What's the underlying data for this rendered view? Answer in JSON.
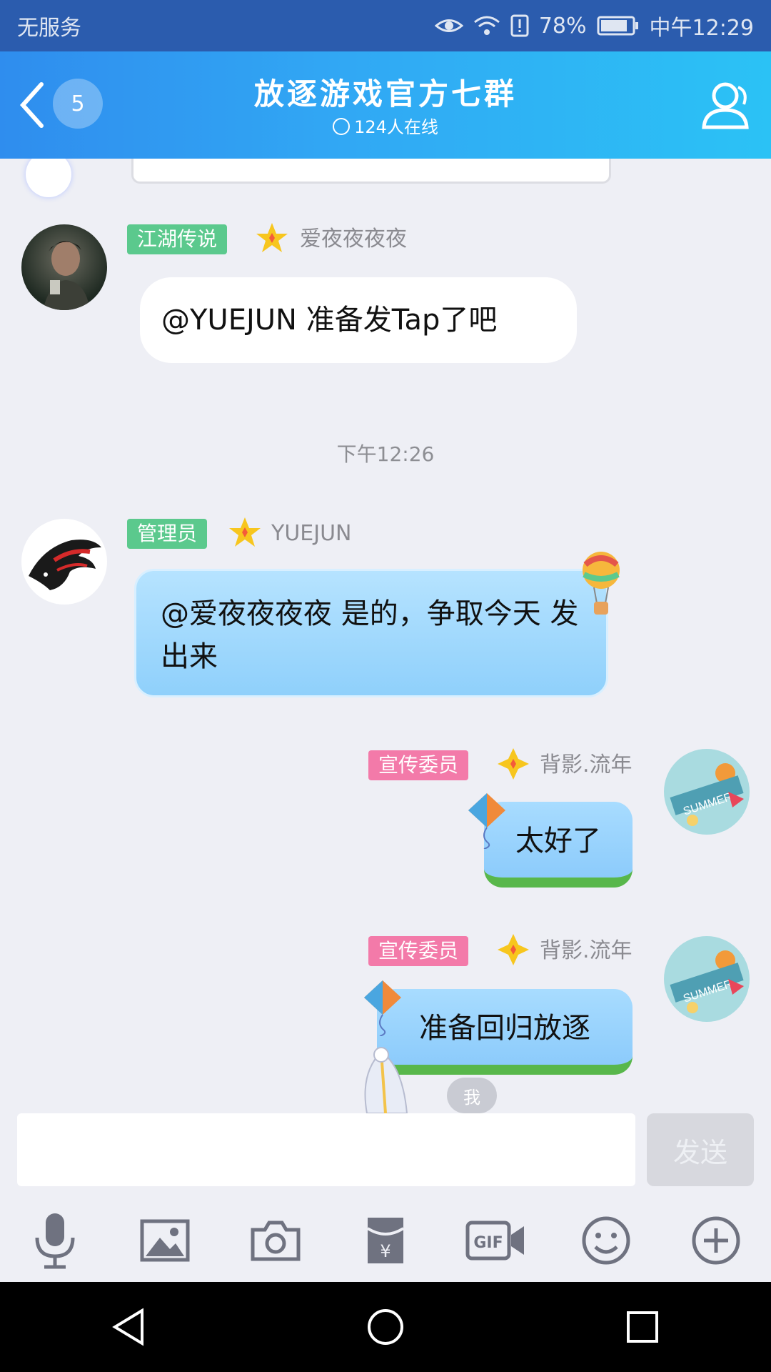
{
  "status_bar": {
    "carrier": "无服务",
    "battery": "78%",
    "time": "中午12:29",
    "icons": [
      "eye-icon",
      "wifi-icon",
      "alert-icon",
      "battery-icon"
    ]
  },
  "header": {
    "unread_count": "5",
    "title": "放逐游戏官方七群",
    "online": "124人在线"
  },
  "messages": [
    {
      "side": "left",
      "tag": "江湖传说",
      "nickname": "爱夜夜夜夜",
      "text": "@YUEJUN 准备发Tap了吧"
    },
    {
      "type": "time",
      "text": "下午12:26"
    },
    {
      "side": "left",
      "tag": "管理员",
      "nickname": "YUEJUN",
      "text": "@爱夜夜夜夜 是的，争取今天 发出来"
    },
    {
      "side": "right",
      "tag": "宣传委员",
      "nickname": "背影.流年",
      "text": "太好了"
    },
    {
      "side": "right",
      "tag": "宣传委员",
      "nickname": "背影.流年",
      "text": "准备回归放逐"
    }
  ],
  "me_label": "我",
  "input": {
    "value": "",
    "send_label": "发送"
  },
  "toolbar_icons": [
    "microphone-icon",
    "image-icon",
    "camera-icon",
    "red-packet-icon",
    "gif-icon",
    "emoji-icon",
    "plus-icon"
  ],
  "colors": {
    "header_start": "#2f8dee",
    "header_end": "#2bc2f5",
    "tag_green": "#5bc98d",
    "tag_pink": "#f37aa9"
  }
}
